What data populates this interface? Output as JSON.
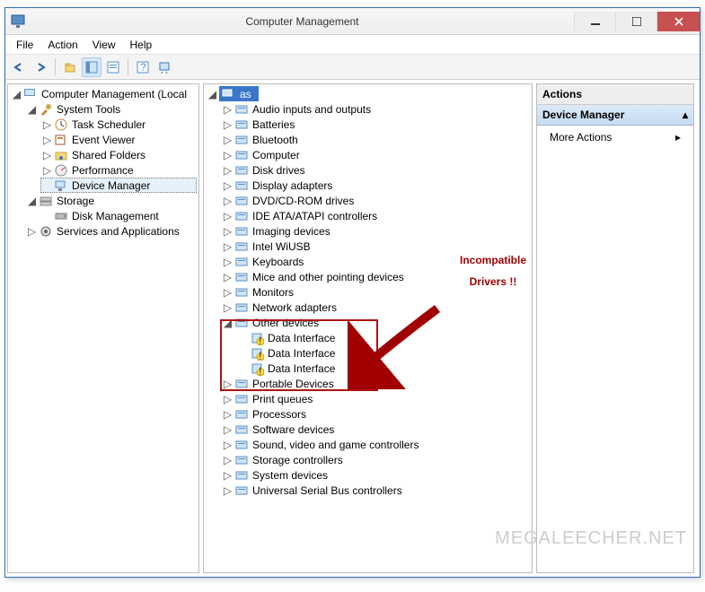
{
  "window": {
    "title": "Computer Management"
  },
  "menu": {
    "file": "File",
    "action": "Action",
    "view": "View",
    "help": "Help"
  },
  "left_tree": {
    "root": "Computer Management (Local",
    "system_tools": "System Tools",
    "task_scheduler": "Task Scheduler",
    "event_viewer": "Event Viewer",
    "shared_folders": "Shared Folders",
    "performance": "Performance",
    "device_manager": "Device Manager",
    "storage": "Storage",
    "disk_management": "Disk Management",
    "services_apps": "Services and Applications"
  },
  "mid_tree": {
    "root": "as",
    "items": [
      "Audio inputs and outputs",
      "Batteries",
      "Bluetooth",
      "Computer",
      "Disk drives",
      "Display adapters",
      "DVD/CD-ROM drives",
      "IDE ATA/ATAPI controllers",
      "Imaging devices",
      "Intel WiUSB",
      "Keyboards",
      "Mice and other pointing devices",
      "Monitors",
      "Network adapters"
    ],
    "other_devices": "Other devices",
    "data_interface": "Data Interface",
    "items2": [
      "Portable Devices",
      "Print queues",
      "Processors",
      "Software devices",
      "Sound, video and game controllers",
      "Storage controllers",
      "System devices",
      "Universal Serial Bus controllers"
    ]
  },
  "actions": {
    "header": "Actions",
    "sub": "Device Manager",
    "more": "More Actions"
  },
  "callout": {
    "line1": "Incompatible",
    "line2": "Drivers !!"
  },
  "watermark": "MEGALEECHER.NET"
}
